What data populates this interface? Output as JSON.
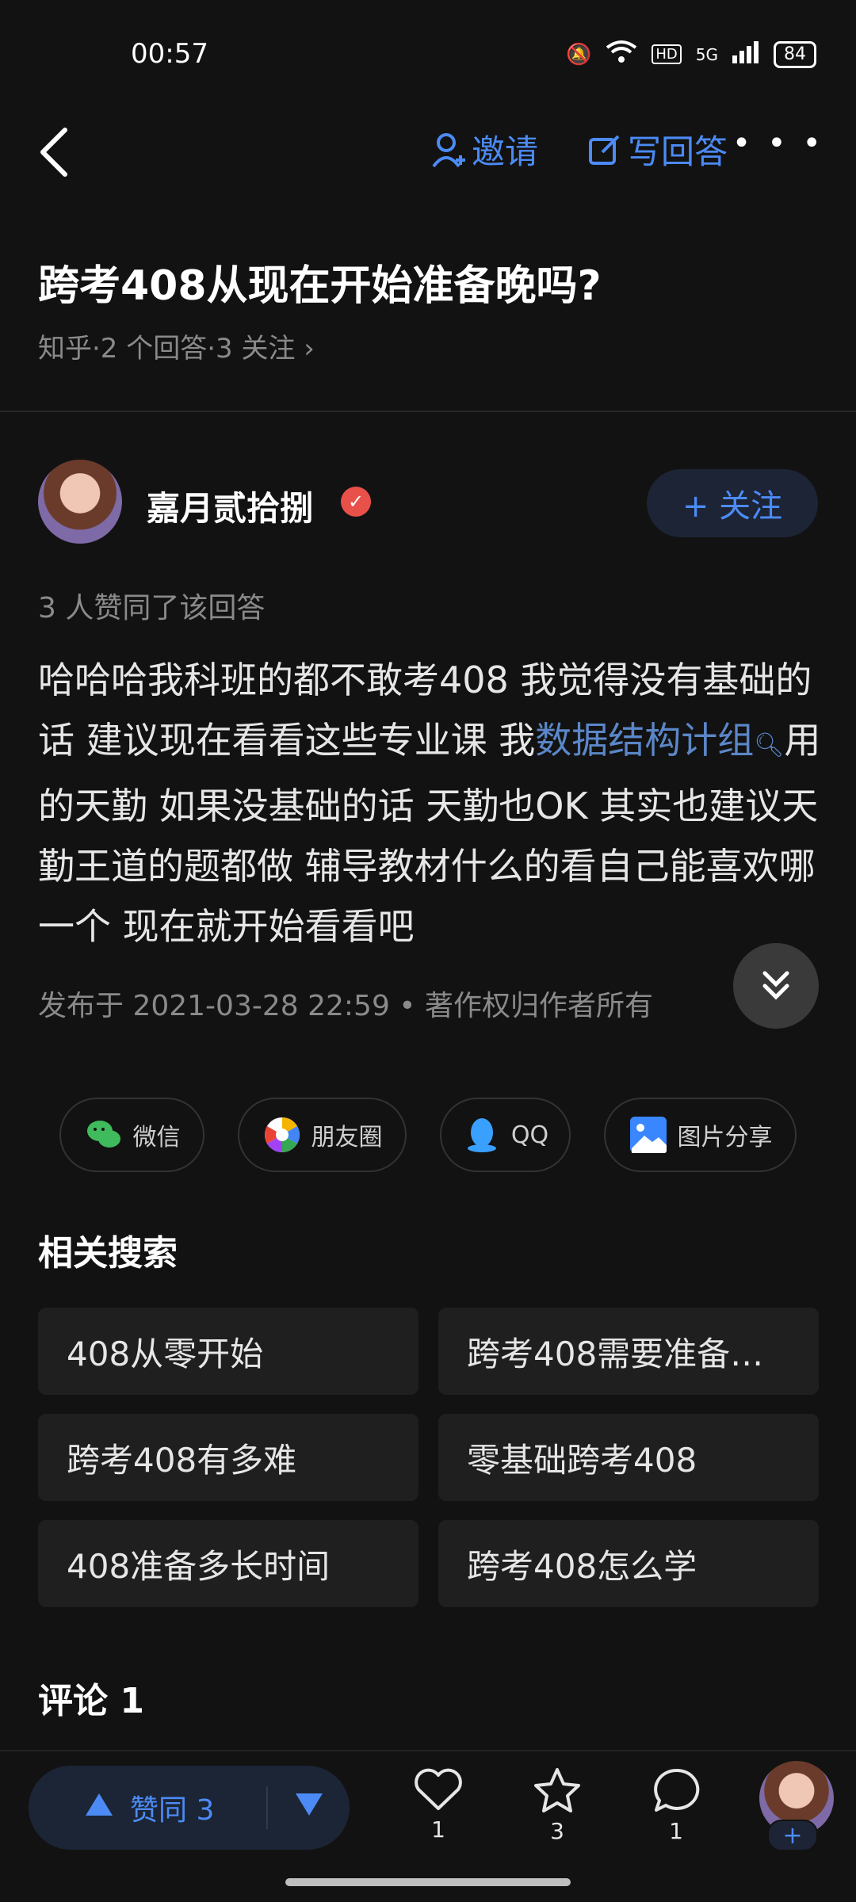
{
  "status_bar": {
    "time": "00:57",
    "battery": "84",
    "signal": "5G",
    "hd": "HD"
  },
  "header": {
    "invite_label": "邀请",
    "write_answer_label": "写回答",
    "more_label": "• • •"
  },
  "question": {
    "title": "跨考408从现在开始准备晚吗?",
    "meta": "知乎·2 个回答·3 关注 ›"
  },
  "answer": {
    "author": "嘉月贰拾捌",
    "follow_label": "+ 关注",
    "likes_text": "3 人赞同了该回答",
    "content_before": "哈哈哈我科班的都不敢考408 我觉得没有基础的话 建议现在看看这些专业课 我",
    "content_link": "数据结构计组",
    "content_after": "用的天勤 如果没基础的话 天勤也OK 其实也建议天勤王道的题都做 辅导教材什么的看自己能喜欢哪一个 现在就开始看看吧",
    "publish_text": "发布于 2021-03-28 22:59 • 著作权归作者所有"
  },
  "share": {
    "items": [
      {
        "label": "微信"
      },
      {
        "label": "朋友圈"
      },
      {
        "label": "QQ"
      },
      {
        "label": "图片分享"
      }
    ]
  },
  "related": {
    "title": "相关搜索",
    "items": [
      "408从零开始",
      "跨考408需要准备…",
      "跨考408有多难",
      "零基础跨考408",
      "408准备多长时间",
      "跨考408怎么学"
    ]
  },
  "comments": {
    "title": "评论 1"
  },
  "bottom": {
    "vote_label": "赞同 3",
    "like_count": "1",
    "favorite_count": "3",
    "comment_count": "1"
  },
  "colors": {
    "accent": "#4c8bf5",
    "background": "#121212",
    "link": "#5b87c8"
  }
}
